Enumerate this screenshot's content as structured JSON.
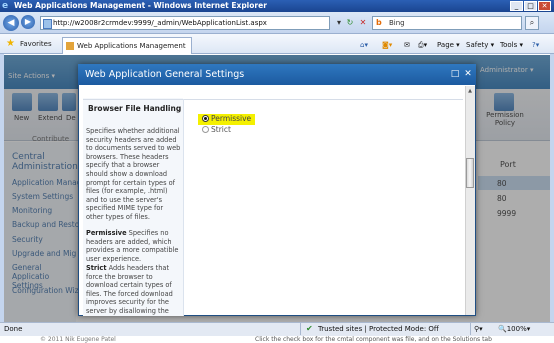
{
  "window": {
    "title": "Web Applications Management - Windows Internet Explorer",
    "minimize": "_",
    "maximize": "□",
    "close": "✕"
  },
  "address_bar": {
    "url": "http://w2008r2crmdev:9999/_admin/WebApplicationList.aspx",
    "search_placeholder": "Bing"
  },
  "favorites_bar": {
    "favorites_label": "Favorites",
    "tab_title": "Web Applications Management",
    "commands": [
      "Page ▾",
      "Safety ▾",
      "Tools ▾"
    ]
  },
  "sharepoint": {
    "site_actions": "Site Actions ▾",
    "admin": "Administrator ▾",
    "ribbon_buttons": [
      "New",
      "Extend",
      "De"
    ],
    "ribbon_group": "Contribute",
    "permission_policy": "Permission Policy",
    "central_admin": "Central Administration",
    "nav_items": [
      "Application Manag",
      "System Settings",
      "Monitoring",
      "Backup and Resto",
      "Security",
      "Upgrade and Mig",
      "General Applicatio Settings",
      "Configuration Wiz"
    ],
    "port_header": "Port",
    "ports": [
      "80",
      "80",
      "9999"
    ]
  },
  "dialog": {
    "title": "Web Application General Settings",
    "maximize_icon": "□",
    "close_icon": "✕",
    "section_title": "Browser File Handling",
    "description_intro": "Specifies whether additional security headers are added to documents served to web browsers. These headers specify that a browser should show a download prompt for certain types of files (for example, .html) and to use the server's specified MIME type for other types of files.",
    "permissive_term": "Permissive",
    "permissive_desc": " Specifies no headers are added, which provides a more compatible user experience.",
    "strict_term": "Strict",
    "strict_desc": " Adds headers that force the browser to download certain types of files. The forced download improves security for the server by disallowing the",
    "options": [
      {
        "label": "Permissive",
        "selected": true
      },
      {
        "label": "Strict",
        "selected": false
      }
    ]
  },
  "status_bar": {
    "done": "Done",
    "zone": "Trusted sites | Protected Mode: Off",
    "zoom": "100%"
  },
  "below_caption": {
    "left": "© 2011 Nik Eugene Patel",
    "right": "Click the check box for the cmtal component was file, and on the Solutions tab"
  },
  "colors": {
    "titlebar": "#1a4590",
    "dialog_header": "#1c5aa0",
    "highlight": "#f4f000"
  }
}
